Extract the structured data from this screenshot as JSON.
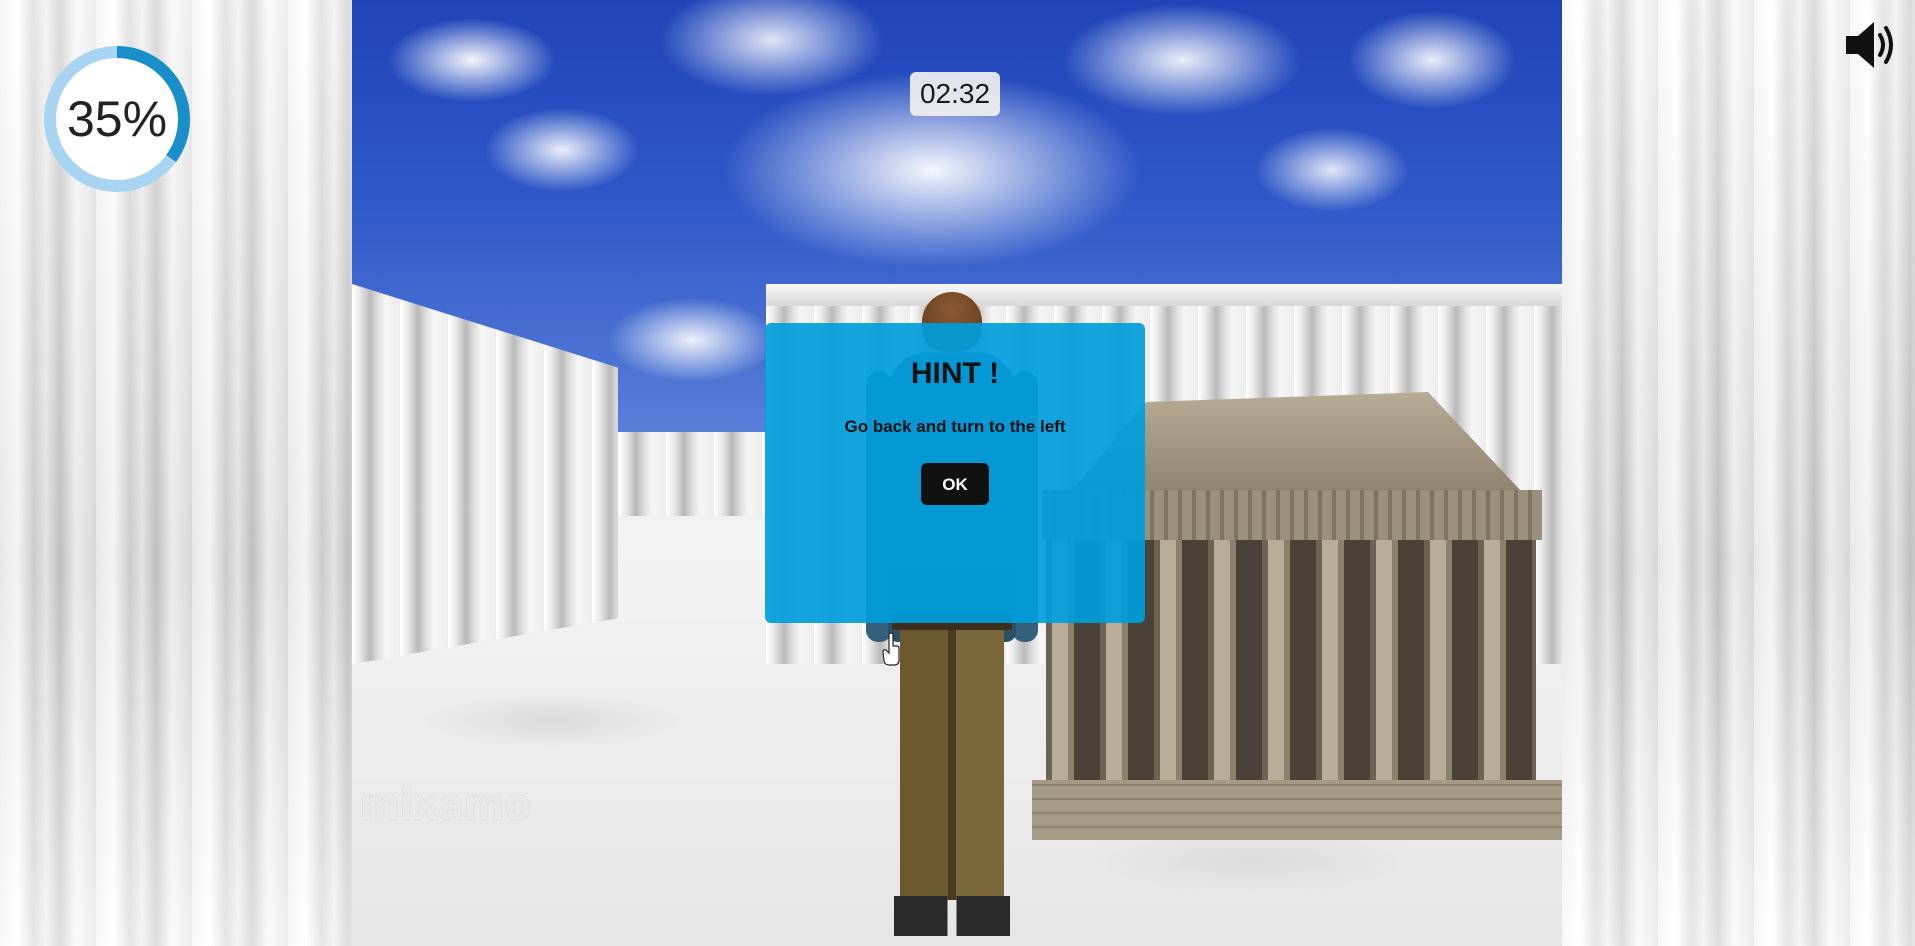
{
  "hud": {
    "progress_percent": 35,
    "progress_label": "35%",
    "timer": "02:32",
    "sound_icon": "speaker-volume-icon"
  },
  "hint_dialog": {
    "title": "HINT !",
    "message": "Go back and turn to the left",
    "ok_label": "OK"
  },
  "scene": {
    "watermark": "mixamo"
  },
  "colors": {
    "dialog": "#009ddc",
    "ring_track": "#a8d4f2",
    "ring_fill": "#1a8ec9",
    "button": "#111111"
  }
}
